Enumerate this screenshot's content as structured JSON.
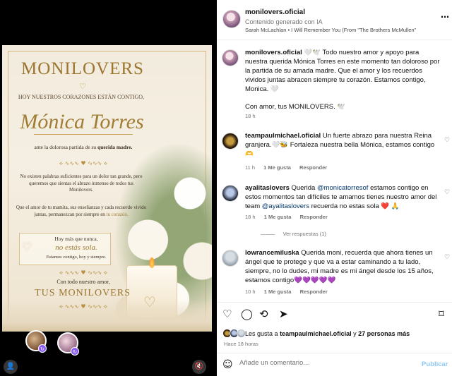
{
  "poster": {
    "title": "MONILOVERS",
    "subtitle": "HOY NUESTROS CORAZONES ESTÁN CONTIGO,",
    "name": "Mónica Torres",
    "condolence_pre": "ante la dolorosa partida de su",
    "condolence_em": "querida madre.",
    "para1": "No existen palabras suficientes para un dolor tan grande, pero queremos que sientas el abrazo inmenso de todos tus Monilovers.",
    "para2_pre": "Que el amor de tu mamita, sus enseñanzas y cada recuerdo vivido juntas, permanezcan por siempre en",
    "para2_em": "tu corazón.",
    "quote_line1": "Hoy más que nunca,",
    "quote_line2": "no estás sola.",
    "quote_line3": "Estamos contigo, hoy y siempre.",
    "amor": "Con todo nuestro amor,",
    "signature": "TUS MONILOVERS",
    "heart_glyph": "♡",
    "ornament": "⟡ ∿∿∿ ♥ ∿∿∿ ⟡"
  },
  "header": {
    "username": "monilovers.oficial",
    "ai_label": "Contenido generado con IA",
    "music": "Sarah McLachlan • I Will Remember You (From \"The Brothers McMullen\"",
    "more_icon": "…"
  },
  "caption": {
    "username": "monilovers.oficial",
    "text": "🤍🕊️ Todo nuestro amor y apoyo para nuestra querida Mónica Torres en este momento tan doloroso por la partida de su amada madre. Que el amor y los recuerdos vividos juntas abracen siempre tu corazón. Estamos contigo, Monica. 🤍",
    "text2": "Con amor, tus MONILOVERS. 🕊️",
    "time": "18 h"
  },
  "comments": [
    {
      "username": "teampaulmichael.oficial",
      "text": "Un fuerte abrazo para nuestra Reina granjera.🤍🐝 Fortaleza nuestra bella Mónica, estamos contigo 🫶",
      "time": "11 h",
      "likes": "1 Me gusta",
      "reply": "Responder"
    },
    {
      "username": "ayalitaslovers",
      "text_pre": "Querida",
      "mention1": "@monicatorresof",
      "text_mid": "estamos contigo en estos momentos tan difíciles te amamos tienes nuestro amor del team",
      "mention2": "@ayalitaslovers",
      "text_post": "recuerda no estas sola ❤️ 🙏",
      "time": "18 h",
      "likes": "1 Me gusta",
      "reply": "Responder",
      "replies": "Ver respuestas (1)"
    },
    {
      "username": "lowrancemiluska",
      "text": "Querida moni, recuerda que ahora tienes un ángel que te protege y que va a estar caminando a tu lado, siempre, no lo dudes, mi madre es mi ángel desde los 15 años, estamos contigo💜💜💜💜💜",
      "time": "10 h",
      "likes": "1 Me gusta",
      "reply": "Responder"
    }
  ],
  "actions": {
    "like_icon": "♡",
    "comment_icon": "◯",
    "repost_icon": "⟲",
    "share_icon": "➤",
    "save_icon": "⌑"
  },
  "likes": {
    "prefix": "Les gusta a",
    "user": "teampaulmichael.oficial",
    "mid": "y",
    "count": "27 personas más"
  },
  "post_time": "Hace 18 horas",
  "add_comment": {
    "emoji_icon": "☺",
    "placeholder": "Añade un comentario...",
    "publish": "Publicar"
  },
  "media_controls": {
    "user_icon": "👤",
    "mute_icon": "🔇",
    "badge_icon": "↻"
  }
}
